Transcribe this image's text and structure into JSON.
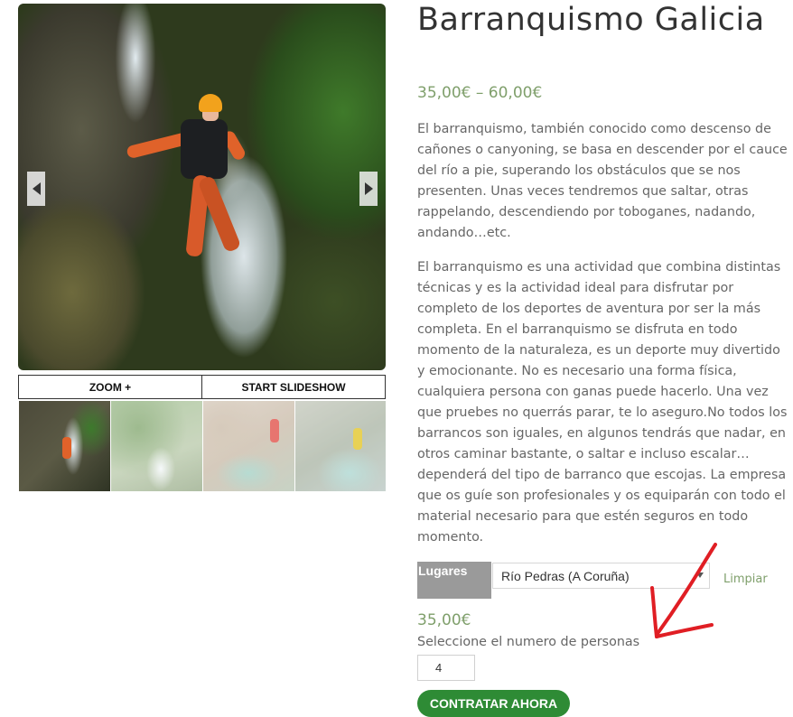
{
  "product": {
    "title": "Barranquismo Galicia",
    "price_range": "35,00€ – 60,00€",
    "description_p1": "El barranquismo, también conocido como descenso de cañones o canyoning, se basa en descender por el cauce del río a pie, superando los obstáculos que se nos presenten. Unas veces tendremos que saltar, otras rappelando, descendiendo por toboganes, nadando, andando…etc.",
    "description_p2": "El barranquismo es una actividad que combina distintas técnicas y es la actividad ideal para disfrutar por completo de los deportes de aventura por ser la más completa. En el barranquismo se disfruta en todo momento de la naturaleza, es un deporte muy divertido y emocionante. No es necesario una forma física, cualquiera persona con ganas puede hacerlo. Una vez que pruebes no querrás parar, te lo aseguro.No todos los barrancos son iguales, en algunos tendrás que nadar, en otros caminar bastante, o saltar e incluso escalar… dependerá del tipo de barranco que escojas. La empresa que os guíe son profesionales y os equiparán con todo el material necesario para que estén seguros en todo momento."
  },
  "gallery": {
    "zoom_label": "ZOOM +",
    "slideshow_label": "START SLIDESHOW",
    "prev_icon": "chevron-left-icon",
    "next_icon": "chevron-right-icon",
    "thumbnail_count": 4
  },
  "variation": {
    "label": "Lugares",
    "selected": "Río Pedras (A Coruña)",
    "clear_label": "Limpiar"
  },
  "purchase": {
    "price": "35,00€",
    "quantity_label": "Seleccione el numero de personas",
    "quantity": "4",
    "buy_label": "CONTRATAR AHORA"
  },
  "colors": {
    "accent_green": "#7f9f6b",
    "button_green": "#2e8b35",
    "annotation_red": "#e01e24"
  }
}
